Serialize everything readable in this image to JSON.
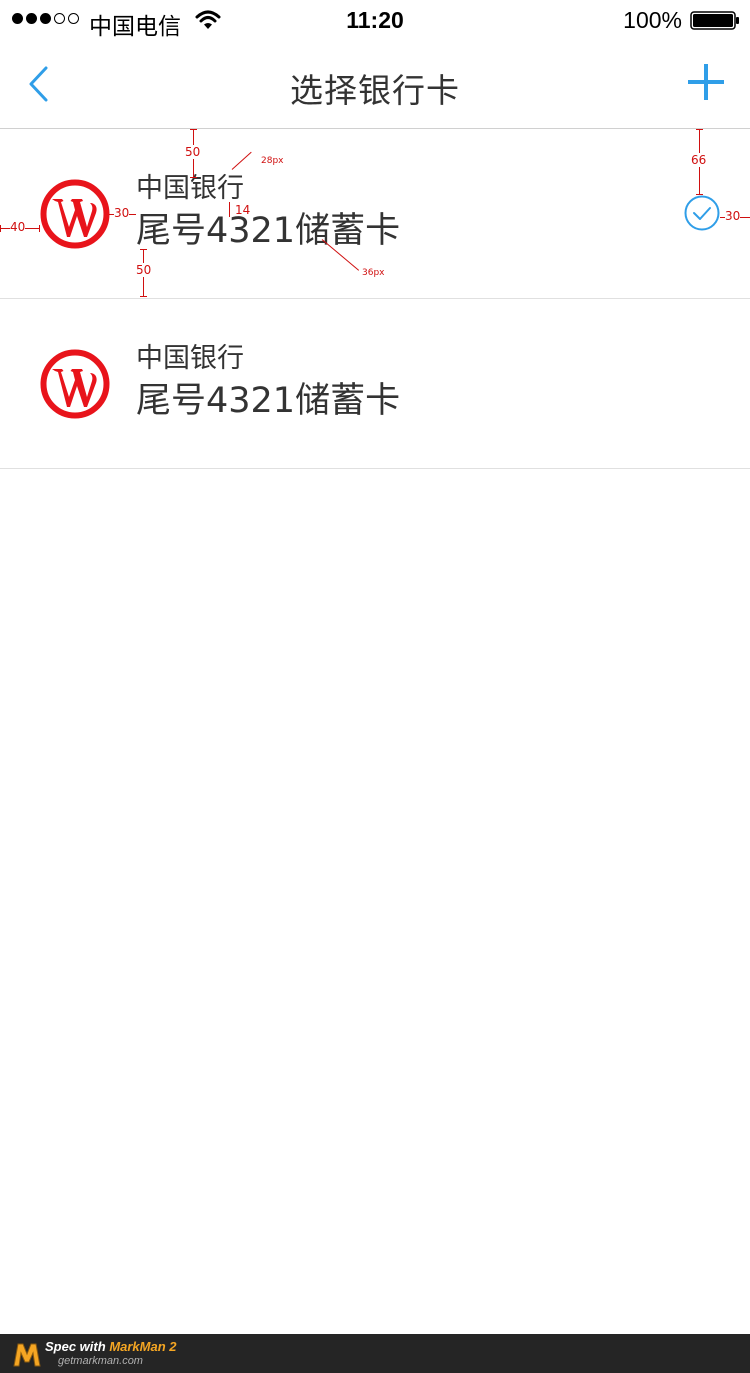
{
  "status_bar": {
    "carrier": "中国电信",
    "time": "11:20",
    "battery": "100%"
  },
  "nav": {
    "title": "选择银行卡",
    "back_icon": "chevron-left-icon",
    "add_icon": "plus-icon"
  },
  "cards": [
    {
      "bank": "中国银行",
      "description": "尾号4321储蓄卡",
      "selected": true
    },
    {
      "bank": "中国银行",
      "description": "尾号4321储蓄卡",
      "selected": false
    }
  ],
  "annotations": {
    "top_padding": "50",
    "bottom_padding": "50",
    "left_padding": "40",
    "logo_gap": "30",
    "bank_font": "28px",
    "line_gap": "14",
    "desc_font": "36px",
    "check_top": "66",
    "check_right": "30"
  },
  "footer": {
    "spec_label": "Spec with",
    "brand": "MarkMan 2",
    "url": "getmarkman.com"
  },
  "colors": {
    "accent": "#2f9ee8",
    "bank_red": "#e8141b",
    "spec_red": "#d01010"
  }
}
